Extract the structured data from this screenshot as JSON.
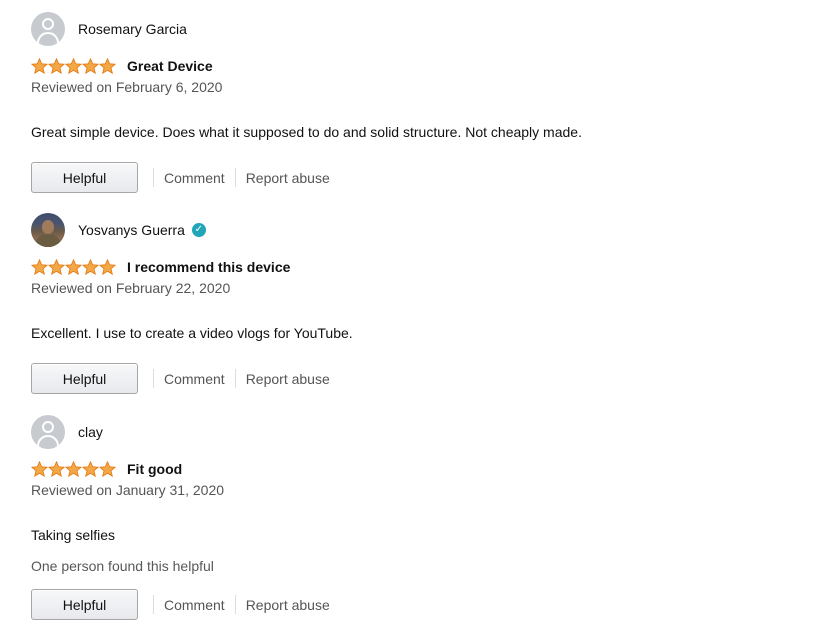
{
  "colors": {
    "star": "#f3a847",
    "star_outline": "#e47911",
    "verified": "#20a6b8",
    "secondary_text": "#555555"
  },
  "reviews": [
    {
      "reviewer": "Rosemary Garcia",
      "avatar": "default-avatar-icon",
      "verified": false,
      "rating": 5,
      "title": "Great Device",
      "date": "Reviewed on February 6, 2020",
      "body": "Great simple device. Does what it supposed to do and solid structure. Not cheaply made.",
      "helpful_count_text": "",
      "helpful_label": "Helpful",
      "comment_label": "Comment",
      "report_label": "Report abuse"
    },
    {
      "reviewer": "Yosvanys Guerra",
      "avatar": "photo-avatar",
      "verified": true,
      "rating": 5,
      "title": "I recommend this device",
      "date": "Reviewed on February 22, 2020",
      "body": "Excellent. I use to create a video vlogs for YouTube.",
      "helpful_count_text": "",
      "helpful_label": "Helpful",
      "comment_label": "Comment",
      "report_label": "Report abuse"
    },
    {
      "reviewer": "clay",
      "avatar": "default-avatar-icon",
      "verified": false,
      "rating": 5,
      "title": "Fit good",
      "date": "Reviewed on January 31, 2020",
      "body": "Taking selfies",
      "helpful_count_text": "One person found this helpful",
      "helpful_label": "Helpful",
      "comment_label": "Comment",
      "report_label": "Report abuse"
    }
  ]
}
